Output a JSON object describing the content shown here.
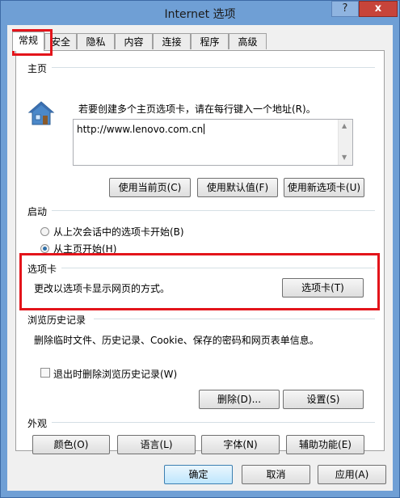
{
  "window": {
    "title": "Internet 选项",
    "help_label": "?",
    "close_label": "x"
  },
  "tabs": [
    "常规",
    "安全",
    "隐私",
    "内容",
    "连接",
    "程序",
    "高级"
  ],
  "home": {
    "header": "主页",
    "instruction": "若要创建多个主页选项卡，请在每行键入一个地址(R)。",
    "url": "http://www.lenovo.com.cn",
    "buttons": [
      "使用当前页(C)",
      "使用默认值(F)",
      "使用新选项卡(U)"
    ]
  },
  "startup": {
    "header": "启动",
    "options": [
      {
        "label": "从上次会话中的选项卡开始(B)",
        "checked": false
      },
      {
        "label": "从主页开始(H)",
        "checked": true
      }
    ]
  },
  "tabs_section": {
    "header": "选项卡",
    "description": "更改以选项卡显示网页的方式。",
    "button": "选项卡(T)"
  },
  "history": {
    "header": "浏览历史记录",
    "description": "删除临时文件、历史记录、Cookie、保存的密码和网页表单信息。",
    "checkbox_label": "退出时删除浏览历史记录(W)",
    "checkbox_checked": false,
    "delete_button": "删除(D)...",
    "settings_button": "设置(S)"
  },
  "appearance": {
    "header": "外观",
    "buttons": [
      "颜色(O)",
      "语言(L)",
      "字体(N)",
      "辅助功能(E)"
    ]
  },
  "footer": {
    "ok": "确定",
    "cancel": "取消",
    "apply": "应用(A)"
  },
  "colors": {
    "highlight": "#e3141b",
    "title_bar": "#6f9fd5",
    "close_button": "#c7443a"
  }
}
